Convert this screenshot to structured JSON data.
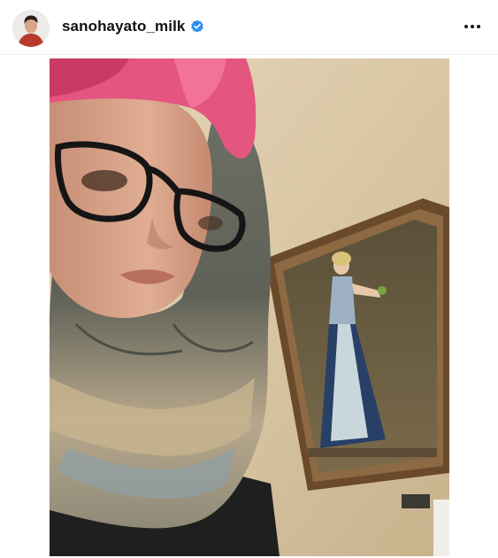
{
  "post": {
    "username": "sanohayato_milk",
    "verified": true,
    "verified_icon": "verified-badge-icon",
    "more_icon": "more-options-icon"
  },
  "colors": {
    "verified_blue": "#2f8ef0",
    "wall": "#d8c7a6",
    "hair": "#e4567f"
  }
}
